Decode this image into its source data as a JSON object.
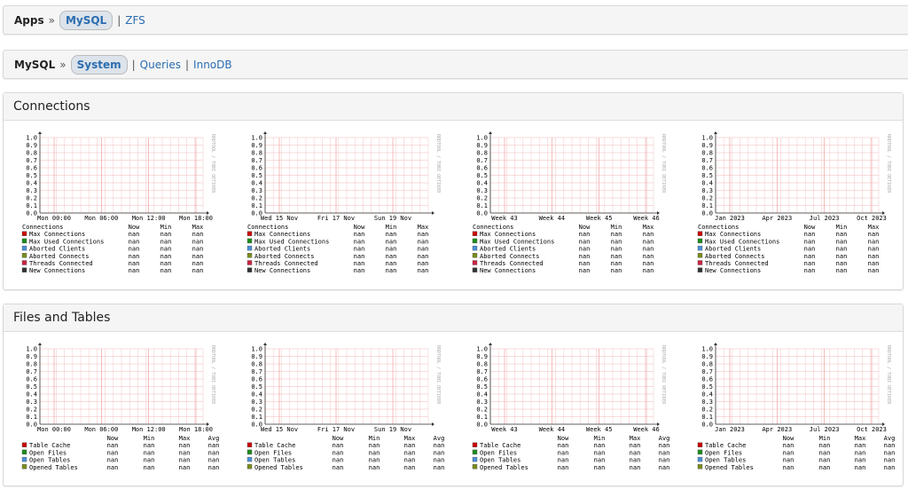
{
  "apps_nav": {
    "label": "Apps",
    "sep": "»",
    "active": "MySQL",
    "links": [
      "ZFS"
    ]
  },
  "mysql_nav": {
    "label": "MySQL",
    "sep": "»",
    "active": "System",
    "links": [
      "Queries",
      "InnoDB"
    ]
  },
  "watermark": "RRDTOOL / TOBI OETIKER",
  "y_ticks": [
    "1.0",
    "0.9",
    "0.8",
    "0.7",
    "0.6",
    "0.5",
    "0.4",
    "0.3",
    "0.2",
    "0.1",
    "0.0"
  ],
  "periods": [
    {
      "x_labels": [
        "Mon 00:00",
        "Mon 06:00",
        "Mon 12:00",
        "Mon 18:00"
      ]
    },
    {
      "x_labels": [
        "Wed 15 Nov",
        "Fri 17 Nov",
        "Sun 19 Nov"
      ]
    },
    {
      "x_labels": [
        "Week 43",
        "Week 44",
        "Week 45",
        "Week 46"
      ]
    },
    {
      "x_labels": [
        "Jan 2023",
        "Apr 2023",
        "Jul 2023",
        "Oct 2023"
      ]
    }
  ],
  "sections": [
    {
      "title": "Connections",
      "legend_title": "Connections",
      "columns": [
        "Now",
        "Min",
        "Max"
      ],
      "items": [
        {
          "label": "Max Connections",
          "color": "#cc0000",
          "values": [
            "nan",
            "nan",
            "nan"
          ]
        },
        {
          "label": "Max Used Connections",
          "color": "#1a8c1a",
          "values": [
            "nan",
            "nan",
            "nan"
          ]
        },
        {
          "label": "Aborted Clients",
          "color": "#4a90d9",
          "values": [
            "nan",
            "nan",
            "nan"
          ]
        },
        {
          "label": "Aborted Connects",
          "color": "#7a8c1a",
          "values": [
            "nan",
            "nan",
            "nan"
          ]
        },
        {
          "label": "Threads Connected",
          "color": "#cc2244",
          "values": [
            "nan",
            "nan",
            "nan"
          ]
        },
        {
          "label": "New Connections",
          "color": "#333333",
          "values": [
            "nan",
            "nan",
            "nan"
          ]
        }
      ]
    },
    {
      "title": "Files and Tables",
      "legend_title": "",
      "columns": [
        "Now",
        "Min",
        "Max",
        "Avg"
      ],
      "items": [
        {
          "label": "Table Cache",
          "color": "#cc0000",
          "values": [
            "nan",
            "nan",
            "nan",
            "nan"
          ]
        },
        {
          "label": "Open Files",
          "color": "#1a8c1a",
          "values": [
            "nan",
            "nan",
            "nan",
            "nan"
          ]
        },
        {
          "label": "Open Tables",
          "color": "#4a90d9",
          "values": [
            "nan",
            "nan",
            "nan",
            "nan"
          ]
        },
        {
          "label": "Opened Tables",
          "color": "#7a8c1a",
          "values": [
            "nan",
            "nan",
            "nan",
            "nan"
          ]
        }
      ]
    }
  ]
}
